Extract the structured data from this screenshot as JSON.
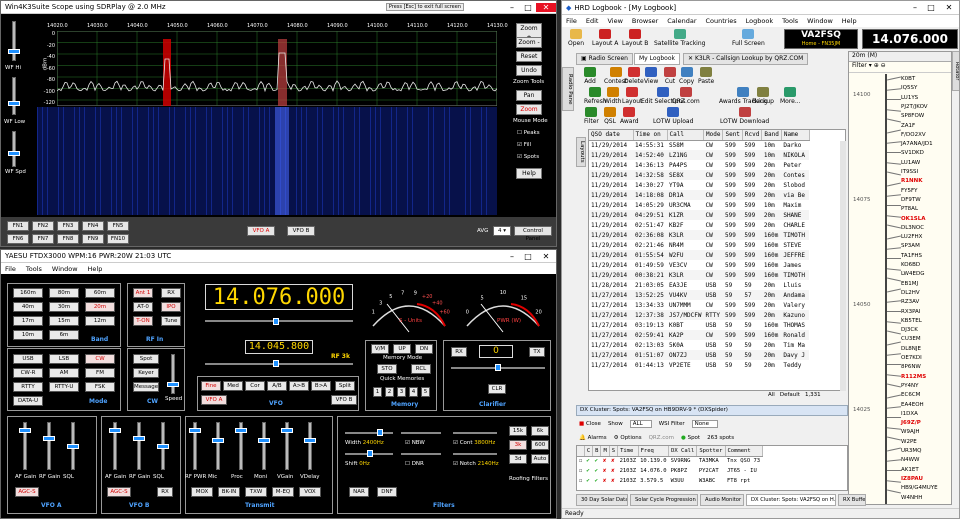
{
  "scope": {
    "title": "Win4K3Suite Scope using SDRPlay @ 2.0 MHz",
    "note": "Press [Esc] to exit full screen",
    "freq_ticks": [
      "14020.0",
      "14030.0",
      "14040.0",
      "14050.0",
      "14060.0",
      "14070.0",
      "14080.0",
      "14090.0",
      "14100.0",
      "14110.0",
      "14120.0",
      "14130.0"
    ],
    "dbm_ticks": [
      "0",
      "-20",
      "-40",
      "-60",
      "-80",
      "-100",
      "-120"
    ],
    "dbm_label": "dBm",
    "wf_hi": "WF Hi",
    "wf_low": "WF Low",
    "wf_spd": "WF Spd",
    "buttons": [
      "Zoom +",
      "Zoom -",
      "Reset",
      "Undo"
    ],
    "zoom_tools": "Zoom Tools",
    "pan": "Pan",
    "zoom": "Zoom",
    "mouse_mode": "Mouse Mode",
    "checks": [
      "Peaks",
      "Fill",
      "Spots"
    ],
    "help": "Help",
    "fn_row1": [
      "FN1",
      "FN2",
      "FN3",
      "FN4",
      "FN5"
    ],
    "fn_row2": [
      "FN6",
      "FN7",
      "FN8",
      "FN9",
      "FN10"
    ],
    "vfo_a": "VFO A",
    "vfo_b": "VFO B",
    "avg": "AVG",
    "avg_val": "4",
    "control_panel": "Control Panel"
  },
  "radio": {
    "title": "YAESU FTDX3000 WPM:16 PWR:20W  21:03 UTC",
    "menu": [
      "File",
      "Tools",
      "Window",
      "Help"
    ],
    "bands": [
      "160m",
      "80m",
      "60m",
      "40m",
      "30m",
      "20m",
      "17m",
      "15m",
      "12m",
      "10m",
      "6m"
    ],
    "band_lbl": "Band",
    "rfin": [
      "Ant 1",
      "RX",
      "AT-0",
      "IPO",
      "T-ON",
      "Tune"
    ],
    "rfin_lbl": "RF In",
    "freq_main": "14.076.000",
    "freq_sub": "14.045.800",
    "rf_lbl": "RF 3k",
    "vfo_btns": [
      "Fine",
      "Med",
      "Cor",
      "A/B",
      "A>B",
      "B>A",
      "Split",
      "VFO A",
      "VFO B"
    ],
    "vfo_lbl": "VFO",
    "mode_btns": [
      "USB",
      "LSB",
      "CW",
      "CW-R",
      "AM",
      "FM",
      "RTTY",
      "RTTY-U",
      "FSK",
      "DATA-U"
    ],
    "mode_lbl": "Mode",
    "cw_btns": [
      "Spot",
      "Keyer",
      "Message"
    ],
    "cw_lbl": "CW",
    "speed_lbl": "Speed",
    "mem_btns": [
      "V/M",
      "UP",
      "DN",
      "STO",
      "RCL"
    ],
    "mem_mode": "Memory Mode",
    "quick_mem": "Quick Memories",
    "quick": [
      "1",
      "2",
      "3",
      "4",
      "5"
    ],
    "mem_lbl": "Memory",
    "clar_btns": [
      "RX",
      "TX",
      "CLR"
    ],
    "clar_val": "0",
    "clar_lbl": "Clarifier",
    "smeter": "S - Units",
    "pwr": "PWR (W)",
    "s_ticks": [
      "1",
      "3",
      "5",
      "7",
      "9",
      "+20",
      "+40",
      "+60"
    ],
    "p_ticks": [
      "0",
      "5",
      "10",
      "15",
      "20"
    ],
    "vfoa_sl": [
      "AF Gain",
      "RF Gain",
      "SQL"
    ],
    "agc_s": "AGC-S",
    "vfoa_lbl": "VFO A",
    "vfob_sl": [
      "AF Gain",
      "RF Gain",
      "SQL"
    ],
    "agc_s2": "AGC-S",
    "rx": "RX",
    "vfob_lbl": "VFO B",
    "tx_sl": [
      "RF PWR",
      "Mic",
      "Proc",
      "Moni",
      "VGain",
      "VDelay"
    ],
    "tx_btns": [
      "MOX",
      "BK-IN",
      "TXW",
      "M-EQ",
      "VOX"
    ],
    "tx_lbl": "Transmit",
    "filt_width": "Width",
    "filt_width_v": "2400Hz",
    "filt_shift": "Shift",
    "filt_shift_v": "0Hz",
    "filt_cont": "Cont",
    "filt_cont_v": "3800Hz",
    "filt_notch": "Notch",
    "filt_notch_v": "2140Hz",
    "filt_nbw": "NBW",
    "filt_dnr": "DNR",
    "filt_btns": [
      "NAR",
      "DNF"
    ],
    "roof": [
      "15k",
      "6k",
      "3k",
      "600",
      "3d",
      "Auto"
    ],
    "roof_lbl": "Roofing Filters",
    "filt_lbl": "Filters"
  },
  "hrd": {
    "title": "HRD Logbook - [My Logbook]",
    "menu": [
      "File",
      "Edit",
      "View",
      "Browser",
      "Calendar",
      "Countries",
      "Logbook",
      "Tools",
      "Window",
      "Help"
    ],
    "toolbar": [
      "Open",
      "Layout A",
      "Layout B",
      "Satellite Tracking",
      "Full Screen"
    ],
    "callsign": "VA2FSQ",
    "callsign_sub": "Home - FN35JM",
    "freq": "14.076.000",
    "band": "20m (M)",
    "tabs": [
      "Radio Screen",
      "My Logbook",
      "K3LR - Callsign Lookup by QRZ.COM"
    ],
    "side_tabs": [
      "Radio Pane",
      "Layouts"
    ],
    "row1": [
      "Add",
      "Contest",
      "Delete",
      "View",
      "Cut",
      "Copy",
      "Paste"
    ],
    "row2": [
      "Refresh",
      "Width",
      "Layout",
      "Edit Selections",
      "QRZ.com",
      "Awards Tracking",
      "Backup",
      "More..."
    ],
    "row3": [
      "Filter",
      "QSL",
      "Award",
      "LOTW Upload",
      "LOTW Download"
    ],
    "columns": [
      "QSO date",
      "Time on",
      "Call",
      "Mode",
      "Sent",
      "Rcvd",
      "Band",
      "Name"
    ],
    "rows": [
      [
        "11/29/2014",
        "14:55:31",
        "S58M",
        "CW",
        "599",
        "599",
        "10m",
        "Darko"
      ],
      [
        "11/29/2014",
        "14:52:40",
        "LZ1NG",
        "CW",
        "599",
        "599",
        "10m",
        "NIKOLA"
      ],
      [
        "11/29/2014",
        "14:36:13",
        "PA4PS",
        "CW",
        "599",
        "599",
        "20m",
        "Peter"
      ],
      [
        "11/29/2014",
        "14:32:58",
        "SE8X",
        "CW",
        "599",
        "599",
        "20m",
        "Contes"
      ],
      [
        "11/29/2014",
        "14:30:27",
        "YT9A",
        "CW",
        "599",
        "599",
        "20m",
        "Slobod"
      ],
      [
        "11/29/2014",
        "14:18:08",
        "DR1A",
        "CW",
        "599",
        "599",
        "20m",
        "via Be"
      ],
      [
        "11/29/2014",
        "14:05:29",
        "UR3CMA",
        "CW",
        "599",
        "599",
        "10m",
        "Maxim"
      ],
      [
        "11/29/2014",
        "04:29:51",
        "K1ZR",
        "CW",
        "599",
        "599",
        "20m",
        "SHANE"
      ],
      [
        "11/29/2014",
        "02:51:47",
        "KB2F",
        "CW",
        "599",
        "599",
        "20m",
        "CHARLE"
      ],
      [
        "11/29/2014",
        "02:36:08",
        "K3LR",
        "CW",
        "599",
        "599",
        "160m",
        "TIMOTH"
      ],
      [
        "11/29/2014",
        "02:21:46",
        "NR4M",
        "CW",
        "599",
        "599",
        "160m",
        "STEVE"
      ],
      [
        "11/29/2014",
        "01:55:54",
        "W2FU",
        "CW",
        "599",
        "599",
        "160m",
        "JEFFRE"
      ],
      [
        "11/29/2014",
        "01:49:59",
        "VE3CV",
        "CW",
        "599",
        "599",
        "160m",
        "James"
      ],
      [
        "11/29/2014",
        "00:38:21",
        "K3LR",
        "CW",
        "599",
        "599",
        "160m",
        "TIMOTH"
      ],
      [
        "11/28/2014",
        "21:03:05",
        "EA3JE",
        "USB",
        "59",
        "59",
        "20m",
        "Lluis"
      ],
      [
        "11/27/2014",
        "13:52:25",
        "VU4KV",
        "USB",
        "59",
        "57",
        "20m",
        "Andama"
      ],
      [
        "11/27/2014",
        "13:34:33",
        "UN7MMM",
        "CW",
        "599",
        "599",
        "20m",
        "Valery"
      ],
      [
        "11/27/2014",
        "12:37:38",
        "JS7/MDCFW",
        "RTTY",
        "599",
        "599",
        "20m",
        "Kazuno"
      ],
      [
        "11/27/2014",
        "03:19:13",
        "K0BT",
        "USB",
        "59",
        "59",
        "160m",
        "THOMAS"
      ],
      [
        "11/27/2014",
        "02:59:41",
        "KA2P",
        "CW",
        "599",
        "599",
        "160m",
        "Ronald"
      ],
      [
        "11/27/2014",
        "02:13:03",
        "5K0A",
        "USB",
        "59",
        "59",
        "20m",
        "Tim Ma"
      ],
      [
        "11/27/2014",
        "01:51:07",
        "ON7ZJ",
        "USB",
        "59",
        "59",
        "20m",
        "Davy J"
      ],
      [
        "11/27/2014",
        "01:44:13",
        "VP2ETE",
        "USB",
        "59",
        "59",
        "20m",
        "Teddy"
      ]
    ],
    "all": "All",
    "default": "Default",
    "count": "1,331",
    "cluster_title": "DX Cluster: Spots: VA2FSQ on HB9DRV-9 * (DXSpider)",
    "cl_close": "Close",
    "cl_show": "Show",
    "cl_all": "ALL",
    "cl_wsi": "WSI Filter",
    "cl_none": "None",
    "cl_alarms": "Alarms",
    "cl_options": "Options",
    "cl_qrz": "QRZ.com",
    "cl_spot": "Spot",
    "cl_spots": "263 spots",
    "cl_cols": [
      "",
      "C",
      "B",
      "M",
      "S",
      "Time",
      "Freq",
      "DX Call",
      "Spotter",
      "Comment"
    ],
    "cl_rows": [
      [
        "2103Z",
        "10.139.0",
        "SV9RNG",
        "TA3MKA",
        "Tnx QSO 73"
      ],
      [
        "2103Z",
        "14.076.0",
        "PK8PZ",
        "PY2CAT",
        "JT65 - IU"
      ],
      [
        "2103Z",
        "3.579.5",
        "W3UU",
        "W3ABC",
        "FT8 rpt"
      ]
    ],
    "bottom_tabs": [
      "30 Day Solar Data",
      "Solar Cycle Progression",
      "Audio Monitor",
      "DX Cluster: Spots: VA2FSQ on H...",
      "RX Buffer"
    ],
    "status": "Ready",
    "bandmap_filter": "Filter",
    "bandmap_calls": [
      {
        "c": "K0BT",
        "col": "#000"
      },
      {
        "c": "IQ5SY",
        "col": "#000"
      },
      {
        "c": "LU1YS",
        "col": "#000"
      },
      {
        "c": "PJ2T/JKOV",
        "col": "#000"
      },
      {
        "c": "SP8FOW",
        "col": "#000"
      },
      {
        "c": "ZA1F",
        "col": "#000"
      },
      {
        "c": "F/DO2XV",
        "col": "#000"
      },
      {
        "c": "JA7ANA/JD1",
        "col": "#000"
      },
      {
        "c": "SV1DKD",
        "col": "#000"
      },
      {
        "c": "LU1AW",
        "col": "#000"
      },
      {
        "c": "IT9SSI",
        "col": "#000"
      },
      {
        "c": "R1NNK",
        "col": "#e00000"
      },
      {
        "c": "FY5FY",
        "col": "#000"
      },
      {
        "c": "DF9TW",
        "col": "#000"
      },
      {
        "c": "PT8AL",
        "col": "#000"
      },
      {
        "c": "OK1SLA",
        "col": "#e00000"
      },
      {
        "c": "DL3NOC",
        "col": "#000"
      },
      {
        "c": "LU2FHX",
        "col": "#000"
      },
      {
        "c": "SP3AM",
        "col": "#000"
      },
      {
        "c": "TA1FHS",
        "col": "#000"
      },
      {
        "c": "KO6BD",
        "col": "#000"
      },
      {
        "c": "LW4EDG",
        "col": "#000"
      },
      {
        "c": "EB1MJ",
        "col": "#000"
      },
      {
        "c": "DL2HV",
        "col": "#000"
      },
      {
        "c": "RZ3AV",
        "col": "#000"
      },
      {
        "c": "RX3PAI",
        "col": "#000"
      },
      {
        "c": "KB5TEL",
        "col": "#000"
      },
      {
        "c": "DJ3CK",
        "col": "#000"
      },
      {
        "c": "CU3EM",
        "col": "#000"
      },
      {
        "c": "DL8NJE",
        "col": "#000"
      },
      {
        "c": "OE7KDI",
        "col": "#000"
      },
      {
        "c": "8P6NW",
        "col": "#000"
      },
      {
        "c": "R112MS",
        "col": "#e00000"
      },
      {
        "c": "PY4NY",
        "col": "#000"
      },
      {
        "c": "EC6CM",
        "col": "#000"
      },
      {
        "c": "EA4EOH",
        "col": "#000"
      },
      {
        "c": "I1DXA",
        "col": "#000"
      },
      {
        "c": "J69Z/P",
        "col": "#e00000"
      },
      {
        "c": "W9AJH",
        "col": "#000"
      },
      {
        "c": "W2PE",
        "col": "#000"
      },
      {
        "c": "UR3MQ",
        "col": "#000"
      },
      {
        "c": "N4WW",
        "col": "#000"
      },
      {
        "c": "AK1ET",
        "col": "#000"
      },
      {
        "c": "IZ8PAU",
        "col": "#e00000"
      },
      {
        "c": "HB9/G4MUYE",
        "col": "#000"
      },
      {
        "c": "W4NHH",
        "col": "#000"
      }
    ],
    "bandmap_ticks": [
      "14100",
      "14075",
      "14050",
      "14025"
    ]
  },
  "taskbar": {
    "close_btn": "Close"
  }
}
